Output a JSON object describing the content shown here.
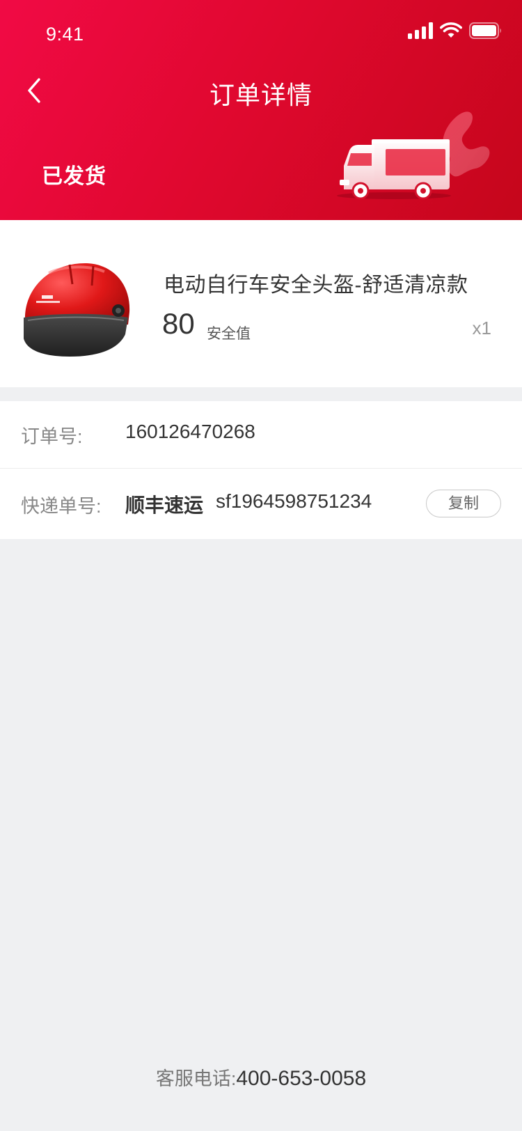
{
  "status_bar": {
    "time": "9:41",
    "icons": [
      "signal-icon",
      "wifi-icon",
      "battery-icon"
    ]
  },
  "nav": {
    "back_icon": "chevron-left-icon",
    "title": "订单详情"
  },
  "order": {
    "status": "已发货",
    "status_illustration": "delivery-truck-icon"
  },
  "product": {
    "name": "电动自行车安全头盔-舒适清凉款",
    "price": "80",
    "price_unit": "安全值",
    "quantity": "x1",
    "image": "red-helmet-image"
  },
  "details": {
    "order_no_label": "订单号:",
    "order_no": "160126470268",
    "express_label": "快递单号:",
    "courier": "顺丰速运",
    "tracking_no": "sf1964598751234",
    "copy_label": "复制"
  },
  "footer": {
    "service_label": "客服电话:",
    "service_phone": "400-653-0058"
  },
  "colors": {
    "header_start": "#f10a45",
    "header_end": "#c5061b",
    "background": "#eff0f2"
  }
}
